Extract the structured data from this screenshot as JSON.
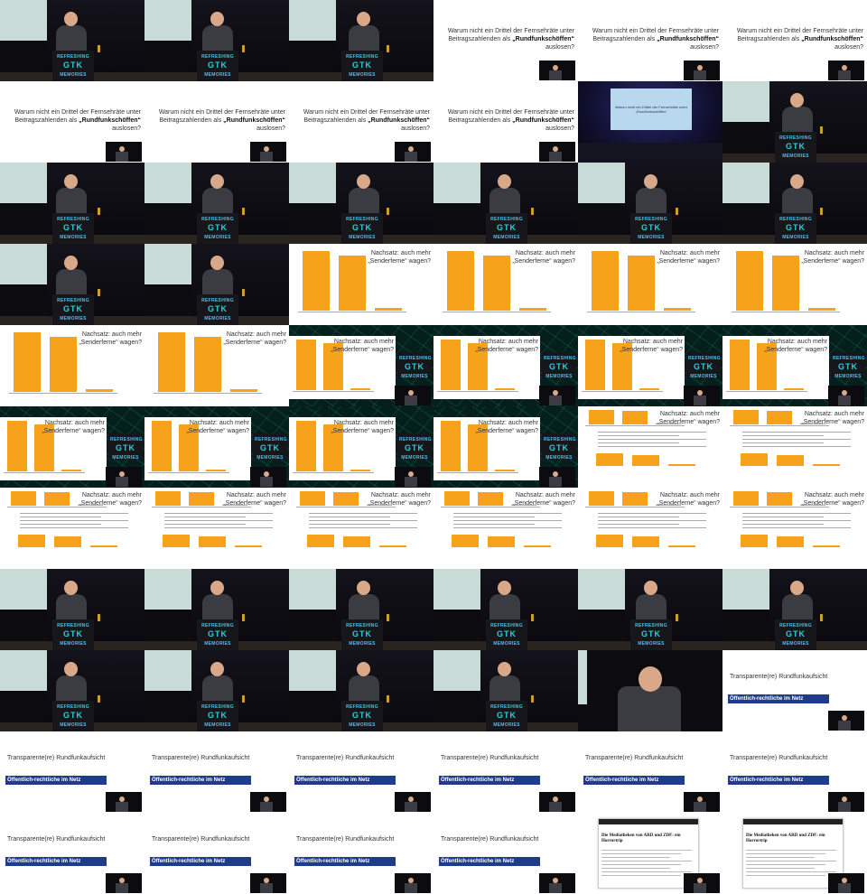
{
  "grid": {
    "columns": 6,
    "rows": 11
  },
  "texts": {
    "question_line1": "Warum nicht ein Drittel der Fernsehräte unter",
    "question_line2_prefix": "Beitragszahlenden als ",
    "question_line2_bold": "„Rundfunkschöffen“",
    "question_line2_suffix": " auslosen?",
    "chart_title_line1": "Nachsatz: auch mehr",
    "chart_title_line2": "„Senderferne“ wagen?",
    "rt_title": "Transparente(re) Rundfunkaufsicht",
    "rt_banner": "Öffentlich-rechtliche im Netz",
    "podium_top": "REFRESHING",
    "podium_mid": "GTK",
    "podium_bot": "MEMORIES",
    "hall_question_line1": "Warum nicht ein Drittel der Fernsehräte unter",
    "hall_question_line2_bold": "„Rundfunkschöffen“",
    "article_line1": "Die Mediatheken von ARD und ZDF: ein",
    "article_line2": "Horrortrip"
  },
  "chart_data": [
    {
      "type": "bar",
      "title": "Nachsatz: auch mehr „Senderferne“ wagen?",
      "categories": [
        "",
        "",
        ""
      ],
      "values": [
        100,
        93,
        4
      ]
    }
  ],
  "colors": {
    "bar": "#f7a21b",
    "banner": "#1f3c8c",
    "podium_text": "#4fc2e6"
  },
  "tiles": [
    "stage",
    "stage",
    "stage",
    "question",
    "question",
    "question",
    "question",
    "question",
    "question",
    "question",
    "hall",
    "stage",
    "stage",
    "stage",
    "stage",
    "stage",
    "stage",
    "stage",
    "stage",
    "stage",
    "chart",
    "chart",
    "chart",
    "chart",
    "chart",
    "chart",
    "chart-net",
    "chart-net",
    "chart-net",
    "chart-net",
    "chart-net",
    "chart-net",
    "chart-net",
    "chart-net",
    "chart-notes",
    "chart-notes",
    "chart-notes",
    "chart-notes",
    "chart-notes",
    "chart-notes",
    "chart-notes",
    "chart-notes",
    "stage",
    "stage",
    "stage",
    "stage",
    "stage",
    "stage",
    "stage",
    "stage",
    "stage",
    "stage",
    "closeup",
    "rt",
    "rt",
    "rt",
    "rt",
    "rt",
    "rt",
    "rt",
    "rt",
    "rt",
    "rt",
    "rt",
    "article",
    "article"
  ]
}
